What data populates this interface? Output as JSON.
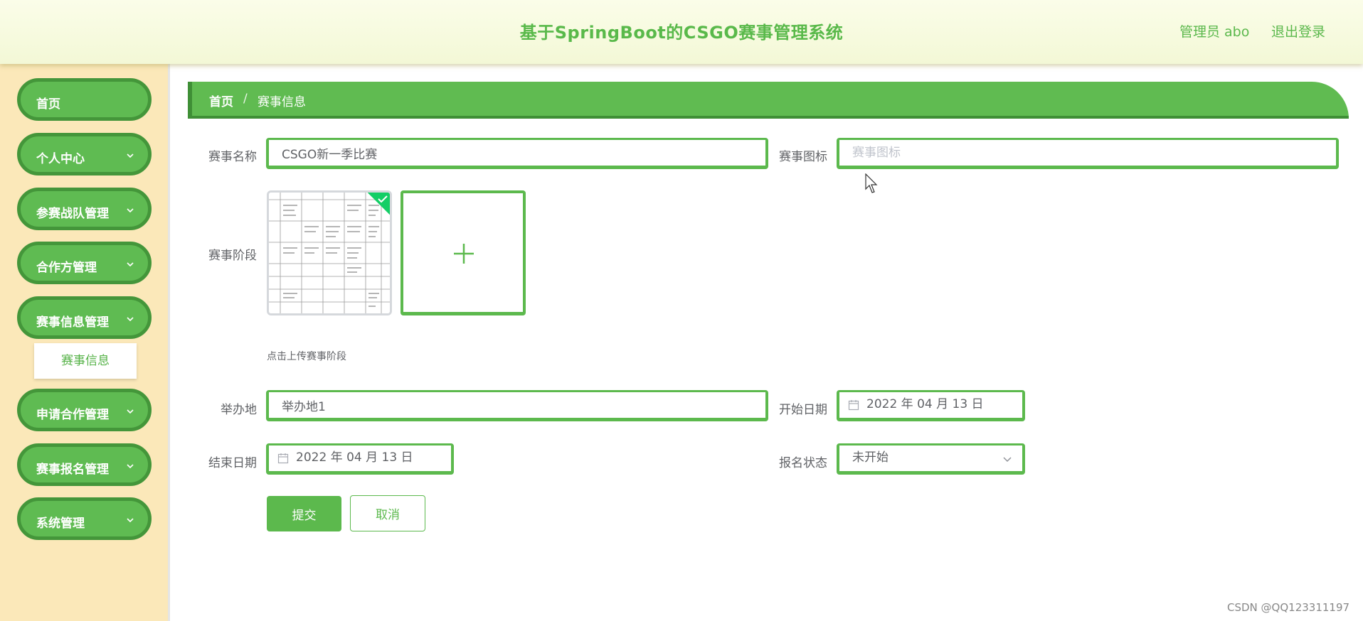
{
  "header": {
    "title": "基于SpringBoot的CSGO赛事管理系统",
    "user": "管理员 abo",
    "logout": "退出登录"
  },
  "sidebar": {
    "items": [
      {
        "label": "首页",
        "has_chevron": false
      },
      {
        "label": "个人中心",
        "has_chevron": true
      },
      {
        "label": "参赛战队管理",
        "has_chevron": true
      },
      {
        "label": "合作方管理",
        "has_chevron": true
      },
      {
        "label": "赛事信息管理",
        "has_chevron": true,
        "expanded": true
      },
      {
        "label": "申请合作管理",
        "has_chevron": true
      },
      {
        "label": "赛事报名管理",
        "has_chevron": true
      },
      {
        "label": "系统管理",
        "has_chevron": true
      }
    ],
    "sub_item": "赛事信息"
  },
  "breadcrumb": {
    "home": "首页",
    "separator": "/",
    "current": "赛事信息"
  },
  "form": {
    "name_label": "赛事名称",
    "name_value": "CSGO新一季比赛",
    "icon_label": "赛事图标",
    "icon_placeholder": "赛事图标",
    "stage_label": "赛事阶段",
    "upload_tip": "点击上传赛事阶段",
    "venue_label": "举办地",
    "venue_value": "举办地1",
    "start_label": "开始日期",
    "start_value": "2022 年 04 月 13 日",
    "end_label": "结束日期",
    "end_value": "2022 年 04 月 13 日",
    "status_label": "报名状态",
    "status_value": "未开始",
    "submit": "提交",
    "cancel": "取消"
  },
  "watermark": "CSDN @QQ123311197",
  "colors": {
    "accent": "#5cb94d",
    "accent_dark": "#3f8f36",
    "sidebar_bg": "#fbe8b9",
    "header_bg": "#f6fadf"
  },
  "icons": [
    "chevron-down-icon",
    "calendar-icon",
    "plus-icon",
    "check-icon",
    "mouse-cursor-icon"
  ]
}
